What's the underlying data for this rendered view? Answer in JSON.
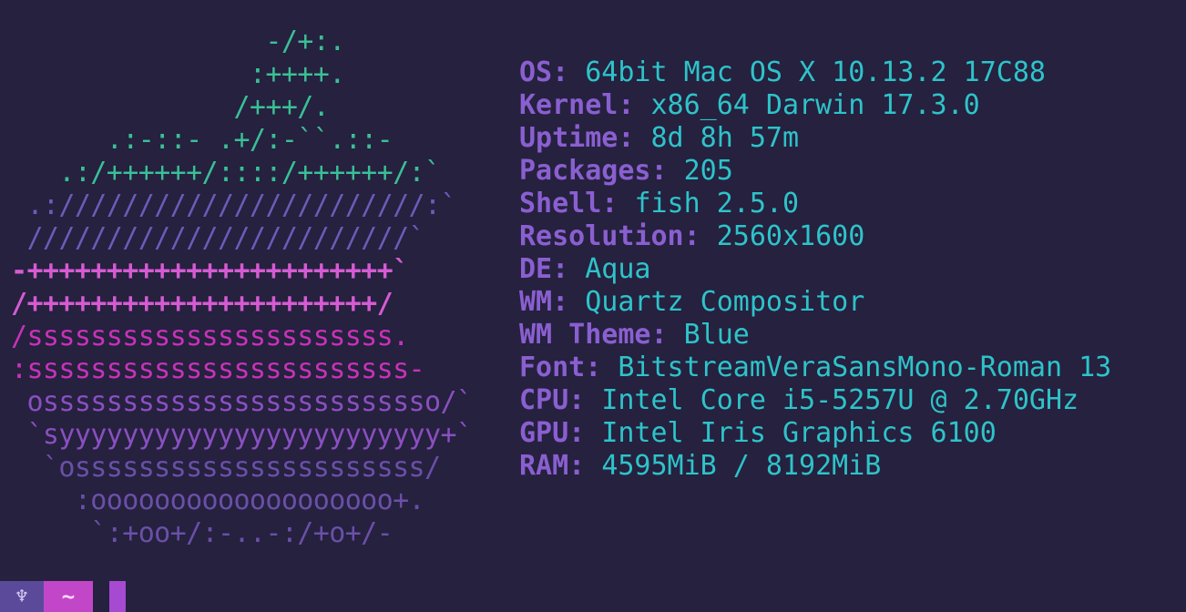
{
  "logo": {
    "lines": [
      {
        "text": "                -/+:.",
        "color": "#3bbf96",
        "bold": false
      },
      {
        "text": "               :++++.",
        "color": "#3bbf96",
        "bold": false
      },
      {
        "text": "              /+++/.",
        "color": "#3bbf96",
        "bold": false
      },
      {
        "text": "      .:-::- .+/:-``.::-",
        "color": "#3bbf96",
        "bold": false
      },
      {
        "text": "   .:/++++++/::::/++++++/:`",
        "color": "#3bbf96",
        "bold": false
      },
      {
        "text": " .:///////////////////////:`",
        "color": "#6b5cb8",
        "bold": false
      },
      {
        "text": " ////////////////////////`",
        "color": "#6b5cb8",
        "bold": false
      },
      {
        "text": "-+++++++++++++++++++++++`",
        "color": "#d55bd3",
        "bold": true
      },
      {
        "text": "/++++++++++++++++++++++/",
        "color": "#d55bd3",
        "bold": true
      },
      {
        "text": "/sssssssssssssssssssssss.",
        "color": "#c832b8",
        "bold": false
      },
      {
        "text": ":ssssssssssssssssssssssss-",
        "color": "#c832b8",
        "bold": false
      },
      {
        "text": " osssssssssssssssssssssssso/`",
        "color": "#8a4fc0",
        "bold": false
      },
      {
        "text": " `syyyyyyyyyyyyyyyyyyyyyyyy+`",
        "color": "#8a4fc0",
        "bold": false
      },
      {
        "text": "  `ossssssssssssssssssssss/",
        "color": "#6b4fa8",
        "bold": false
      },
      {
        "text": "    :ooooooooooooooooooo+.",
        "color": "#6b4fa8",
        "bold": false
      },
      {
        "text": "     `:+oo+/:-..-:/+o+/-",
        "color": "#6b4fa8",
        "bold": false
      }
    ]
  },
  "info": [
    {
      "key": "OS:",
      "value": "64bit Mac OS X 10.13.2 17C88"
    },
    {
      "key": "Kernel:",
      "value": "x86_64 Darwin 17.3.0"
    },
    {
      "key": "Uptime:",
      "value": "8d 8h 57m"
    },
    {
      "key": "Packages:",
      "value": "205"
    },
    {
      "key": "Shell:",
      "value": "fish 2.5.0"
    },
    {
      "key": "Resolution:",
      "value": "2560x1600"
    },
    {
      "key": "DE:",
      "value": "Aqua"
    },
    {
      "key": "WM:",
      "value": "Quartz Compositor"
    },
    {
      "key": "WM Theme:",
      "value": "Blue"
    },
    {
      "key": "Font:",
      "value": "BitstreamVeraSansMono-Roman 13"
    },
    {
      "key": "CPU:",
      "value": "Intel Core i5-5257U @ 2.70GHz"
    },
    {
      "key": "GPU:",
      "value": "Intel Iris Graphics 6100"
    },
    {
      "key": "RAM:",
      "value": "4595MiB / 8192MiB"
    }
  ],
  "prompt": {
    "user_symbol": "♆",
    "directory": "~"
  },
  "colors": {
    "background": "#25213f",
    "key": "#8a5fd0",
    "value": "#2ec3c9"
  }
}
